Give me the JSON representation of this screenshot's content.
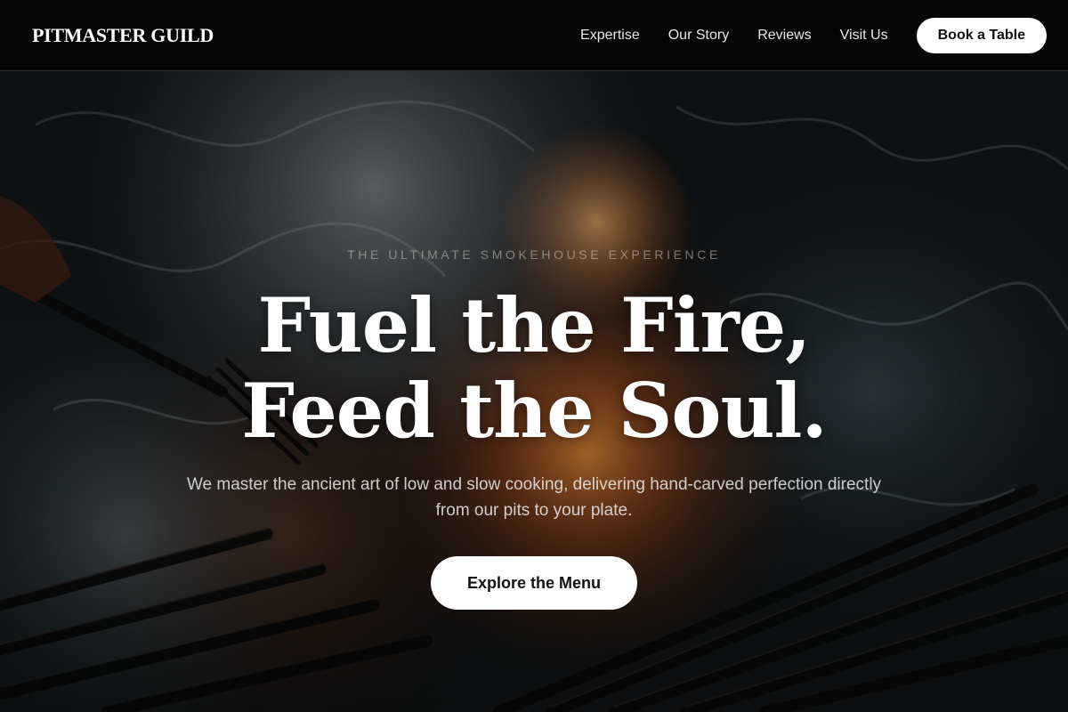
{
  "brand": {
    "name": "PITMASTER GUILD"
  },
  "nav": {
    "links": [
      {
        "label": "Expertise"
      },
      {
        "label": "Our Story"
      },
      {
        "label": "Reviews"
      },
      {
        "label": "Visit Us"
      }
    ],
    "cta_label": "Book a Table"
  },
  "hero": {
    "eyebrow": "THE ULTIMATE SMOKEHOUSE EXPERIENCE",
    "headline_line1": "Fuel the Fire,",
    "headline_line2": "Feed the Soul.",
    "subtext": "We master the ancient art of low and slow cooking, delivering hand-carved perfection directly from our pits to your plate.",
    "cta_label": "Explore the Menu",
    "background_image": "smoking-grill-with-meat-and-fire"
  },
  "colors": {
    "nav_background": "#050505",
    "button_background": "#ffffff",
    "button_text": "#111111",
    "headline_text": "#ffffff",
    "fire_accent": "#d96a1e"
  }
}
